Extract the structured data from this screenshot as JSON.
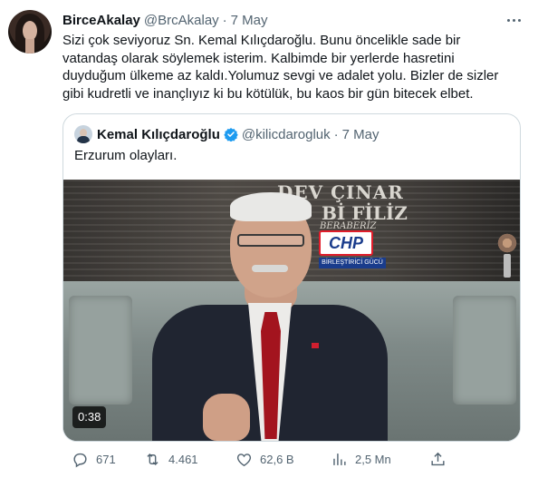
{
  "author": {
    "name": "BirceAkalay",
    "handle": "@BrcAkalay",
    "separator": "·",
    "date": "7 May"
  },
  "tweet_text_lines": [
    "Sizi çok seviyoruz Sn. Kemal Kılıçdaroğlu. Bunu öncelikle sade bir",
    "vatandaş olarak söylemek isterim. Kalbimde bir yerlerde hasretini",
    "duyduğum ülkeme az kaldı.Yolumuz sevgi ve adalet yolu. Bizler de sizler",
    "gibi kudretli ve inançlıyız ki bu kötülük, bu kaos bir gün bitecek elbet."
  ],
  "quoted": {
    "name": "Kemal Kılıçdaroğlu",
    "handle": "@kilicdarogluk",
    "separator": "·",
    "date": "7 May",
    "text": "Erzurum olayları.",
    "video_duration": "0:38",
    "verified_color": "#1d9bf0",
    "video_signage": {
      "line1": "DEV ÇINAR",
      "line2": "Bİ FİLİZ",
      "line3": "BERABERİZ",
      "logo": "CHP",
      "logo_sub": "BİRLEŞTİRİCİ GÜCÜ"
    }
  },
  "actions": {
    "replies": "671",
    "reposts": "4.461",
    "likes": "62,6 B",
    "views": "2,5 Mn"
  },
  "icons": [
    "more-icon",
    "verified-icon",
    "reply-icon",
    "repost-icon",
    "like-icon",
    "views-icon",
    "share-icon"
  ]
}
